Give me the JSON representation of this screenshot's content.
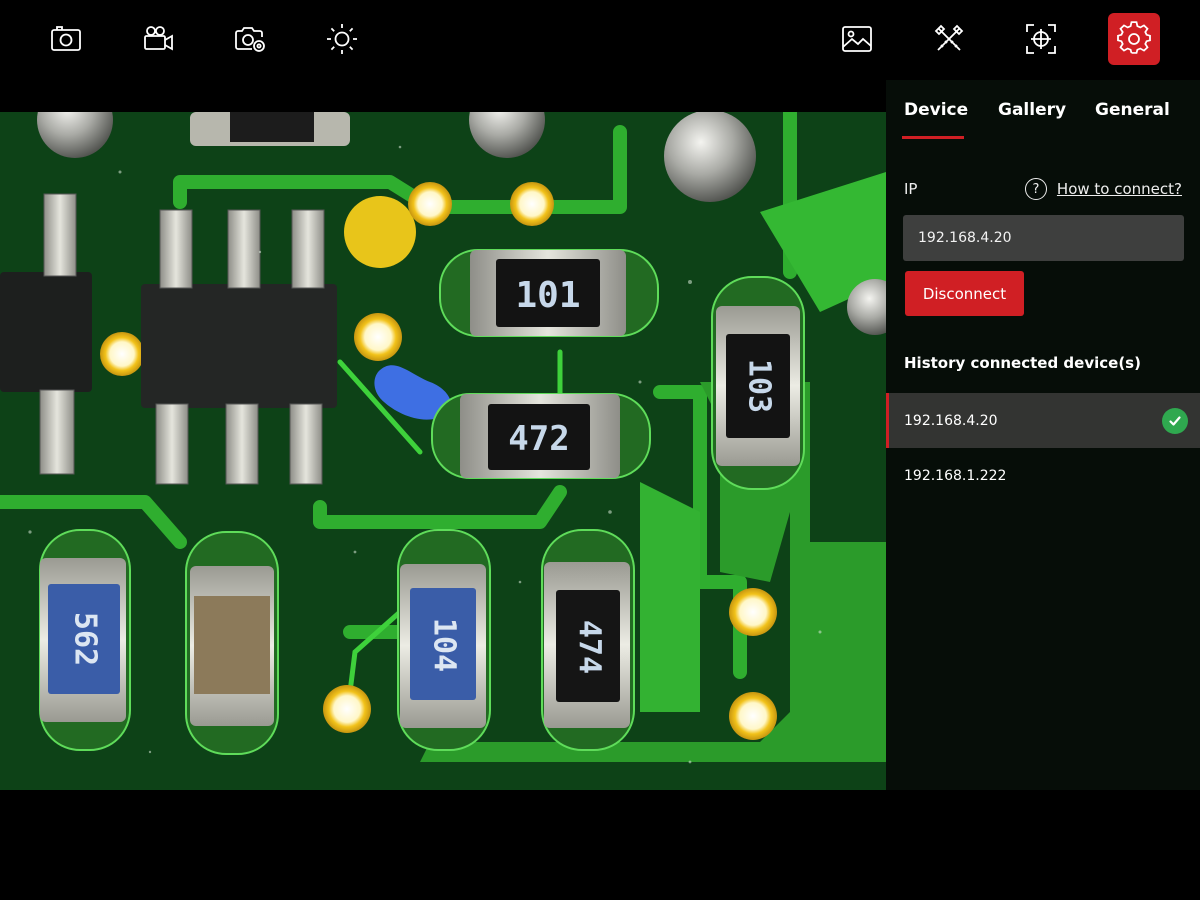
{
  "toolbar": {
    "left_buttons": [
      "photo-camera-icon",
      "video-camera-icon",
      "camera-settings-icon",
      "brightness-icon"
    ],
    "right_buttons": [
      "gallery-icon",
      "measure-tools-icon",
      "focus-target-icon",
      "settings-icon"
    ],
    "active": "settings-icon",
    "accent_color": "#d01f24"
  },
  "settings": {
    "tabs": [
      "Device",
      "Gallery",
      "General"
    ],
    "active_tab": "Device",
    "ip_label": "IP",
    "help_link": "How to connect?",
    "ip_value": "192.168.4.20",
    "disconnect_label": "Disconnect",
    "history_title": "History connected device(s)",
    "history": [
      {
        "ip": "192.168.4.20",
        "connected": true
      },
      {
        "ip": "192.168.1.222",
        "connected": false
      }
    ]
  },
  "viewer": {
    "component_markings": [
      "101",
      "472",
      "103",
      "562",
      "104",
      "474"
    ]
  }
}
